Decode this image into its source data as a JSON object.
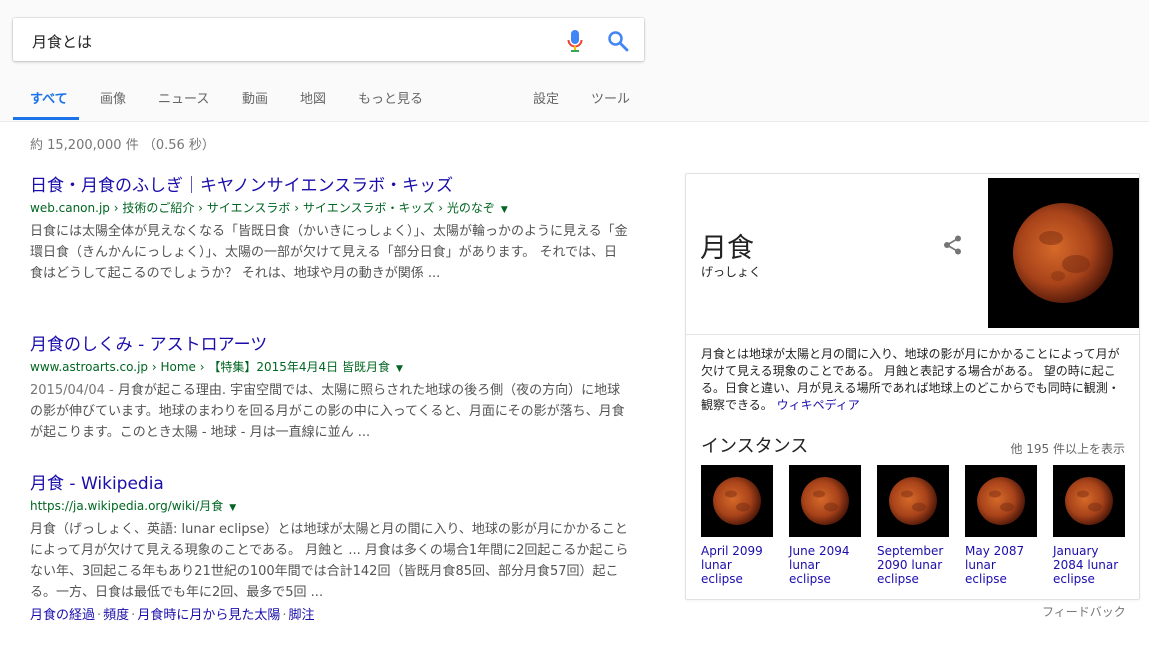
{
  "search": {
    "query": "月食とは"
  },
  "tabs": {
    "all": "すべて",
    "images": "画像",
    "news": "ニュース",
    "videos": "動画",
    "maps": "地図",
    "more": "もっと見る",
    "settings": "設定",
    "tools": "ツール"
  },
  "stats": "約 15,200,000 件 （0.56 秒）",
  "results": [
    {
      "title": "日食・月食のふしぎ｜キヤノンサイエンスラボ・キッズ",
      "url": "web.canon.jp › 技術のご紹介 › サイエンスラボ › サイエンスラボ・キッズ › 光のなぞ",
      "snippet": "日食には太陽全体が見えなくなる「皆既日食（かいきにっしょく）」、太陽が輪っかのように見える「金環日食（きんかんにっしょく）」、太陽の一部が欠けて見える「部分日食」があります。 それでは、日食はどうして起こるのでしょうか？ それは、地球や月の動きが関係 ..."
    },
    {
      "title": "月食のしくみ - アストロアーツ",
      "url": "www.astroarts.co.jp › Home › 【特集】2015年4月4日 皆既月食",
      "date": "2015/04/04 - ",
      "snippet": "月食が起こる理由. 宇宙空間では、太陽に照らされた地球の後ろ側（夜の方向）に地球の影が伸びています。地球のまわりを回る月がこの影の中に入ってくると、月面にその影が落ち、月食が起こります。このとき太陽 - 地球 - 月は一直線に並ん ..."
    },
    {
      "title": "月食 - Wikipedia",
      "url": "https://ja.wikipedia.org/wiki/月食",
      "snippet": "月食（げっしょく、英語: lunar eclipse）とは地球が太陽と月の間に入り、地球の影が月にかかることによって月が欠けて見える現象のことである。 月蝕と ... 月食は多くの場合1年間に2回起こるか起こらない年、3回起こる年もあり21世紀の100年間では合計142回（皆既月食85回、部分月食57回）起こる。一方、日食は最低でも年に2回、最多で5回 ...",
      "sitelinks": [
        "月食の経過",
        "頻度",
        "月食時に月から見た太陽",
        "脚注"
      ]
    }
  ],
  "knowledge_panel": {
    "title": "月食",
    "subtitle": "げっしょく",
    "description": "月食とは地球が太陽と月の間に入り、地球の影が月にかかることによって月が欠けて見える現象のことである。 月蝕と表記する場合がある。 望の時に起こる。日食と違い、月が見える場所であれば地球上のどこからでも同時に観測・観察できる。",
    "source_link": "ウィキペディア",
    "section_title": "インスタンス",
    "more_label": "他 195 件以上を表示",
    "instances": [
      {
        "caption": "April 2099 lunar eclipse"
      },
      {
        "caption": "June 2094 lunar eclipse"
      },
      {
        "caption": "September 2090 lunar eclipse"
      },
      {
        "caption": "May 2087 lunar eclipse"
      },
      {
        "caption": "January 2084 lunar eclipse"
      }
    ]
  },
  "feedback": "フィードバック",
  "colors": {
    "link": "#1a0dab",
    "url": "#006621",
    "accent": "#1a73e8"
  }
}
